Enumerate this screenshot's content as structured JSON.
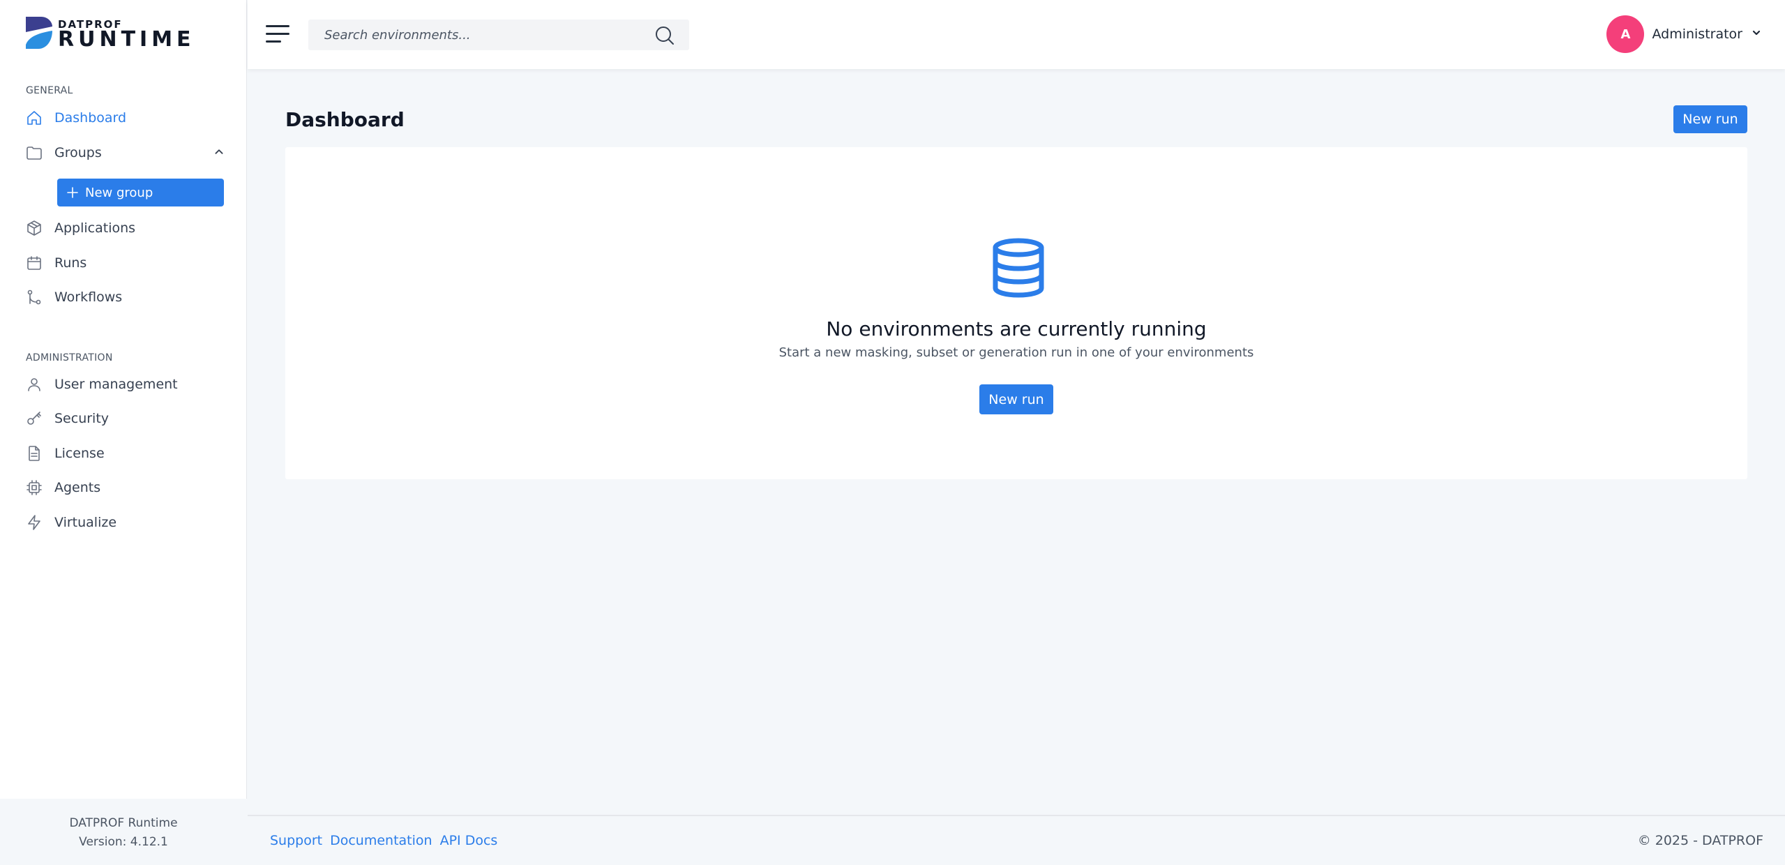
{
  "brand": {
    "small": "DATPROF",
    "big": "RUNTIME",
    "colors": {
      "mark_top": "#3b3f8f",
      "mark_bottom": "#2b8fe0"
    }
  },
  "sidebar": {
    "general_title": "GENERAL",
    "general_items": [
      {
        "label": "Dashboard",
        "icon": "home-icon",
        "active": true
      },
      {
        "label": "Groups",
        "icon": "folder-icon",
        "expanded": true
      },
      {
        "label": "Applications",
        "icon": "cube-icon"
      },
      {
        "label": "Runs",
        "icon": "calendar-icon"
      },
      {
        "label": "Workflows",
        "icon": "git-flow-icon"
      }
    ],
    "new_group_label": "New group",
    "admin_title": "ADMINISTRATION",
    "admin_items": [
      {
        "label": "User management",
        "icon": "user-icon"
      },
      {
        "label": "Security",
        "icon": "key-icon"
      },
      {
        "label": "License",
        "icon": "document-icon"
      },
      {
        "label": "Agents",
        "icon": "chip-icon"
      },
      {
        "label": "Virtualize",
        "icon": "lightning-icon"
      }
    ],
    "footer": {
      "product": "DATPROF Runtime",
      "version": "Version: 4.12.1"
    }
  },
  "header": {
    "search_placeholder": "Search environments...",
    "user": {
      "initial": "A",
      "name": "Administrator",
      "avatar_color": "#f43f7a"
    }
  },
  "main": {
    "title": "Dashboard",
    "new_run_label": "New run",
    "empty_state": {
      "icon": "database-icon",
      "title": "No environments are currently running",
      "subtitle": "Start a new masking, subset or generation run in one of your environments",
      "button_label": "New run"
    }
  },
  "footer": {
    "links": [
      "Support",
      "Documentation",
      "API Docs"
    ],
    "copyright": "© 2025 - DATPROF"
  },
  "colors": {
    "accent": "#2b7de9",
    "background": "#f4f7fa"
  }
}
